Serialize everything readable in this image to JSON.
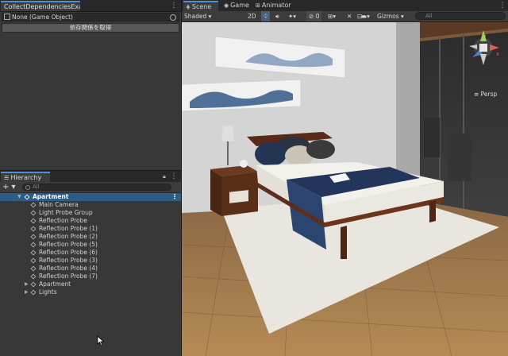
{
  "inspector": {
    "tab_title": "CollectDependenciesExa...",
    "object_field": "None (Game Object)",
    "release_button": "依存関係を取得"
  },
  "hierarchy": {
    "tab_title": "Hierarchy",
    "add_label": "+ ▾",
    "search_placeholder": "All",
    "scene_name": "Apartment",
    "items": [
      {
        "label": "Main Camera"
      },
      {
        "label": "Light Probe Group"
      },
      {
        "label": "Reflection Probe"
      },
      {
        "label": "Reflection Probe (1)"
      },
      {
        "label": "Reflection Probe (2)"
      },
      {
        "label": "Reflection Probe (5)"
      },
      {
        "label": "Reflection Probe (6)"
      },
      {
        "label": "Reflection Probe (3)"
      },
      {
        "label": "Reflection Probe (4)"
      },
      {
        "label": "Reflection Probe (7)"
      },
      {
        "label": "Apartment",
        "expandable": true
      },
      {
        "label": "Lights",
        "expandable": true
      }
    ]
  },
  "scene_view": {
    "tabs": [
      {
        "label": "Scene",
        "icon": "scene-icon",
        "active": true
      },
      {
        "label": "Game",
        "icon": "game-icon"
      },
      {
        "label": "Animator",
        "icon": "animator-icon"
      }
    ],
    "shading_mode": "Shaded",
    "mode_2d": "2D",
    "hidden_count": "0",
    "gizmos_label": "Gizmos",
    "search_placeholder": "All",
    "projection": "Persp",
    "axis_y": "y",
    "axis_x": "x"
  },
  "colors": {
    "accent": "#4d8ed9",
    "selection": "#2c5d87",
    "panel": "#383838",
    "toolbar": "#3c3c3c"
  }
}
